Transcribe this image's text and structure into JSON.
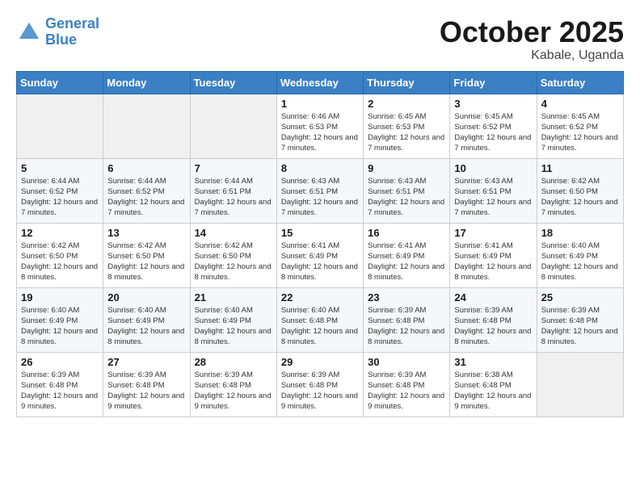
{
  "header": {
    "logo_line1": "General",
    "logo_line2": "Blue",
    "month": "October 2025",
    "location": "Kabale, Uganda"
  },
  "weekdays": [
    "Sunday",
    "Monday",
    "Tuesday",
    "Wednesday",
    "Thursday",
    "Friday",
    "Saturday"
  ],
  "weeks": [
    [
      {
        "day": "",
        "info": ""
      },
      {
        "day": "",
        "info": ""
      },
      {
        "day": "",
        "info": ""
      },
      {
        "day": "1",
        "info": "Sunrise: 6:46 AM\nSunset: 6:53 PM\nDaylight: 12 hours\nand 7 minutes."
      },
      {
        "day": "2",
        "info": "Sunrise: 6:45 AM\nSunset: 6:53 PM\nDaylight: 12 hours\nand 7 minutes."
      },
      {
        "day": "3",
        "info": "Sunrise: 6:45 AM\nSunset: 6:52 PM\nDaylight: 12 hours\nand 7 minutes."
      },
      {
        "day": "4",
        "info": "Sunrise: 6:45 AM\nSunset: 6:52 PM\nDaylight: 12 hours\nand 7 minutes."
      }
    ],
    [
      {
        "day": "5",
        "info": "Sunrise: 6:44 AM\nSunset: 6:52 PM\nDaylight: 12 hours\nand 7 minutes."
      },
      {
        "day": "6",
        "info": "Sunrise: 6:44 AM\nSunset: 6:52 PM\nDaylight: 12 hours\nand 7 minutes."
      },
      {
        "day": "7",
        "info": "Sunrise: 6:44 AM\nSunset: 6:51 PM\nDaylight: 12 hours\nand 7 minutes."
      },
      {
        "day": "8",
        "info": "Sunrise: 6:43 AM\nSunset: 6:51 PM\nDaylight: 12 hours\nand 7 minutes."
      },
      {
        "day": "9",
        "info": "Sunrise: 6:43 AM\nSunset: 6:51 PM\nDaylight: 12 hours\nand 7 minutes."
      },
      {
        "day": "10",
        "info": "Sunrise: 6:43 AM\nSunset: 6:51 PM\nDaylight: 12 hours\nand 7 minutes."
      },
      {
        "day": "11",
        "info": "Sunrise: 6:42 AM\nSunset: 6:50 PM\nDaylight: 12 hours\nand 7 minutes."
      }
    ],
    [
      {
        "day": "12",
        "info": "Sunrise: 6:42 AM\nSunset: 6:50 PM\nDaylight: 12 hours\nand 8 minutes."
      },
      {
        "day": "13",
        "info": "Sunrise: 6:42 AM\nSunset: 6:50 PM\nDaylight: 12 hours\nand 8 minutes."
      },
      {
        "day": "14",
        "info": "Sunrise: 6:42 AM\nSunset: 6:50 PM\nDaylight: 12 hours\nand 8 minutes."
      },
      {
        "day": "15",
        "info": "Sunrise: 6:41 AM\nSunset: 6:49 PM\nDaylight: 12 hours\nand 8 minutes."
      },
      {
        "day": "16",
        "info": "Sunrise: 6:41 AM\nSunset: 6:49 PM\nDaylight: 12 hours\nand 8 minutes."
      },
      {
        "day": "17",
        "info": "Sunrise: 6:41 AM\nSunset: 6:49 PM\nDaylight: 12 hours\nand 8 minutes."
      },
      {
        "day": "18",
        "info": "Sunrise: 6:40 AM\nSunset: 6:49 PM\nDaylight: 12 hours\nand 8 minutes."
      }
    ],
    [
      {
        "day": "19",
        "info": "Sunrise: 6:40 AM\nSunset: 6:49 PM\nDaylight: 12 hours\nand 8 minutes."
      },
      {
        "day": "20",
        "info": "Sunrise: 6:40 AM\nSunset: 6:49 PM\nDaylight: 12 hours\nand 8 minutes."
      },
      {
        "day": "21",
        "info": "Sunrise: 6:40 AM\nSunset: 6:49 PM\nDaylight: 12 hours\nand 8 minutes."
      },
      {
        "day": "22",
        "info": "Sunrise: 6:40 AM\nSunset: 6:48 PM\nDaylight: 12 hours\nand 8 minutes."
      },
      {
        "day": "23",
        "info": "Sunrise: 6:39 AM\nSunset: 6:48 PM\nDaylight: 12 hours\nand 8 minutes."
      },
      {
        "day": "24",
        "info": "Sunrise: 6:39 AM\nSunset: 6:48 PM\nDaylight: 12 hours\nand 8 minutes."
      },
      {
        "day": "25",
        "info": "Sunrise: 6:39 AM\nSunset: 6:48 PM\nDaylight: 12 hours\nand 8 minutes."
      }
    ],
    [
      {
        "day": "26",
        "info": "Sunrise: 6:39 AM\nSunset: 6:48 PM\nDaylight: 12 hours\nand 9 minutes."
      },
      {
        "day": "27",
        "info": "Sunrise: 6:39 AM\nSunset: 6:48 PM\nDaylight: 12 hours\nand 9 minutes."
      },
      {
        "day": "28",
        "info": "Sunrise: 6:39 AM\nSunset: 6:48 PM\nDaylight: 12 hours\nand 9 minutes."
      },
      {
        "day": "29",
        "info": "Sunrise: 6:39 AM\nSunset: 6:48 PM\nDaylight: 12 hours\nand 9 minutes."
      },
      {
        "day": "30",
        "info": "Sunrise: 6:39 AM\nSunset: 6:48 PM\nDaylight: 12 hours\nand 9 minutes."
      },
      {
        "day": "31",
        "info": "Sunrise: 6:38 AM\nSunset: 6:48 PM\nDaylight: 12 hours\nand 9 minutes."
      },
      {
        "day": "",
        "info": ""
      }
    ]
  ]
}
